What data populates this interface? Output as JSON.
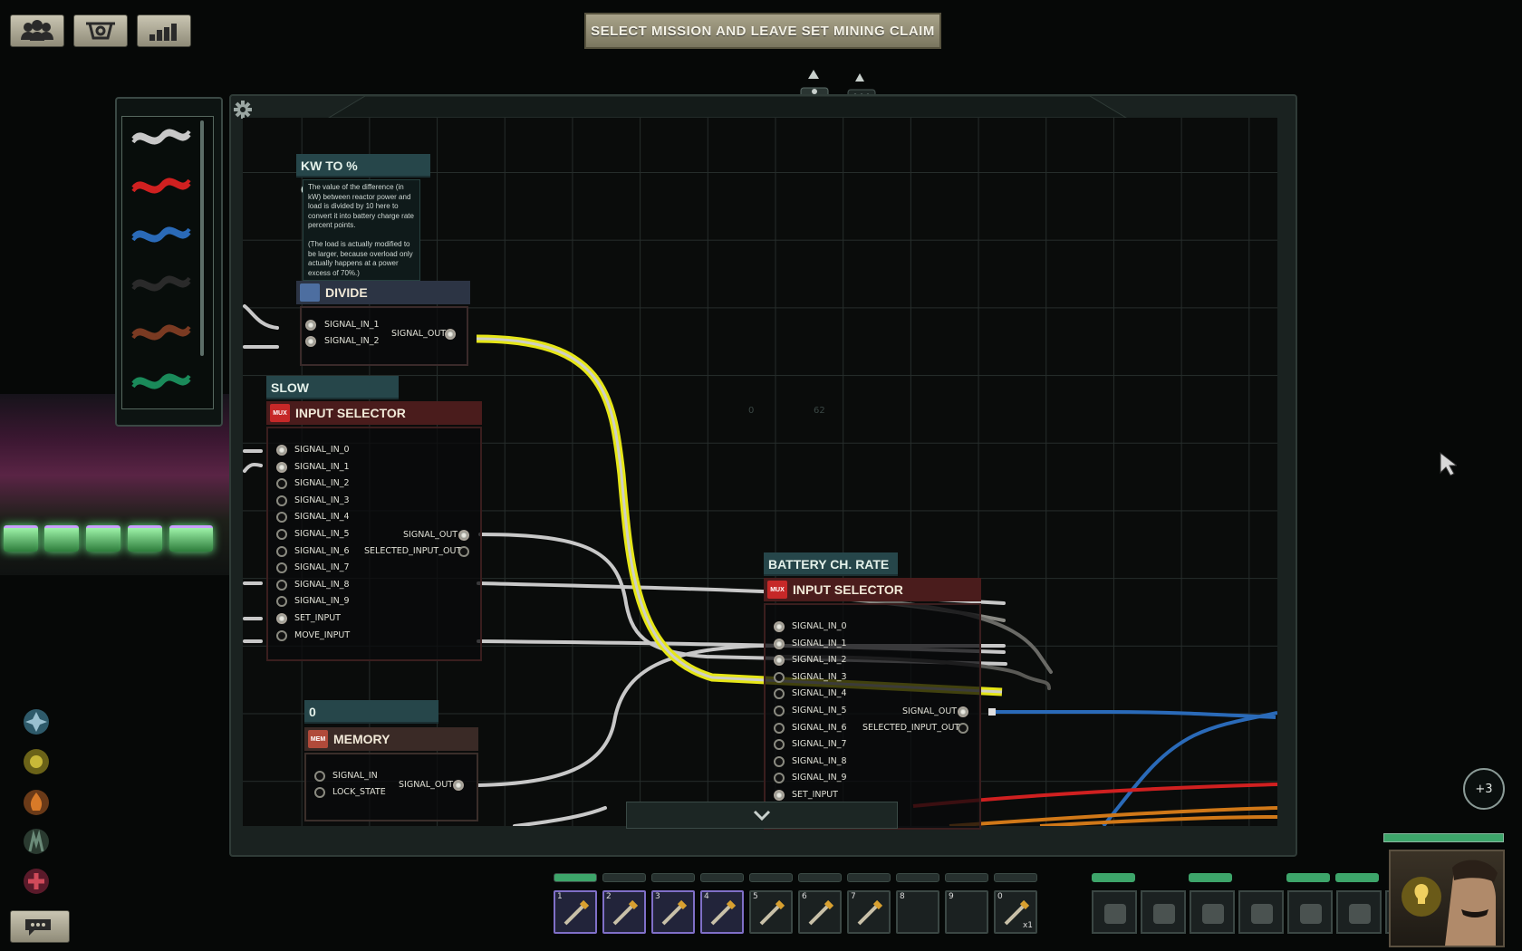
{
  "mission_button": "SELECT MISSION AND LEAVE SET MINING CLAIM",
  "top_icons": [
    "crew-icon",
    "submarine-icon",
    "stats-icon"
  ],
  "wire_colors": [
    "#c8c8c8",
    "#d02020",
    "#2a6ab8",
    "#2a2a2a",
    "#7a3a22",
    "#1a8a5a"
  ],
  "components": {
    "kw_label": "KW TO % CONVERSION",
    "kw_note": "The value of the difference (in kW) between reactor power and load is divided by 10 here to convert it into battery charge rate percent points.\n\n(The load is actually modified to be larger, because overload only actually happens at a power excess of 70%.)",
    "divide": {
      "title": "DIVIDE",
      "inputs": [
        "SIGNAL_IN_1",
        "SIGNAL_IN_2"
      ],
      "output": "SIGNAL_OUT"
    },
    "slow_label": "SLOW IN-/DECREASE",
    "selector1": {
      "title": "INPUT SELECTOR",
      "icon_text": "MUX",
      "inputs": [
        "SIGNAL_IN_0",
        "SIGNAL_IN_1",
        "SIGNAL_IN_2",
        "SIGNAL_IN_3",
        "SIGNAL_IN_4",
        "SIGNAL_IN_5",
        "SIGNAL_IN_6",
        "SIGNAL_IN_7",
        "SIGNAL_IN_8",
        "SIGNAL_IN_9",
        "SET_INPUT",
        "MOVE_INPUT"
      ],
      "outputs": [
        "SIGNAL_OUT",
        "SELECTED_INPUT_OUT"
      ]
    },
    "battery_label": "BATTERY CH. RATE",
    "selector2": {
      "title": "INPUT SELECTOR",
      "icon_text": "MUX",
      "inputs": [
        "SIGNAL_IN_0",
        "SIGNAL_IN_1",
        "SIGNAL_IN_2",
        "SIGNAL_IN_3",
        "SIGNAL_IN_4",
        "SIGNAL_IN_5",
        "SIGNAL_IN_6",
        "SIGNAL_IN_7",
        "SIGNAL_IN_8",
        "SIGNAL_IN_9",
        "SET_INPUT"
      ],
      "outputs": [
        "SIGNAL_OUT",
        "SELECTED_INPUT_OUT"
      ]
    },
    "memory_label": "0",
    "memory": {
      "title": "MEMORY",
      "icon_text": "MEM",
      "inputs": [
        "SIGNAL_IN",
        "LOCK_STATE"
      ],
      "output": "SIGNAL_OUT"
    }
  },
  "bg_numbers": [
    "0",
    "62"
  ],
  "side_buttons": [
    "skill-icon-1",
    "skill-icon-2",
    "skill-icon-3",
    "skill-icon-4",
    "skill-icon-5"
  ],
  "hotbar": {
    "numbers": [
      "1",
      "2",
      "3",
      "4",
      "5",
      "6",
      "7",
      "8",
      "9",
      "0"
    ],
    "items": [
      "screwdriver",
      "wrench",
      "welding-tool",
      "screwdriver",
      "diving-mask",
      "flashlight",
      "fire-extinguisher",
      "",
      "",
      "health-scanner"
    ],
    "last_count": "x1"
  },
  "plus_counter": "+3",
  "equipment": [
    "gun",
    "helmet",
    "jacket",
    "suit",
    "goggles",
    "gloves",
    "id-card"
  ],
  "colors": {
    "accent": "#e6e617",
    "signal_wire": "#c8c8c8",
    "blue_wire": "#2a6ab8",
    "red_wire": "#d02020",
    "orange_wire": "#d07818"
  }
}
